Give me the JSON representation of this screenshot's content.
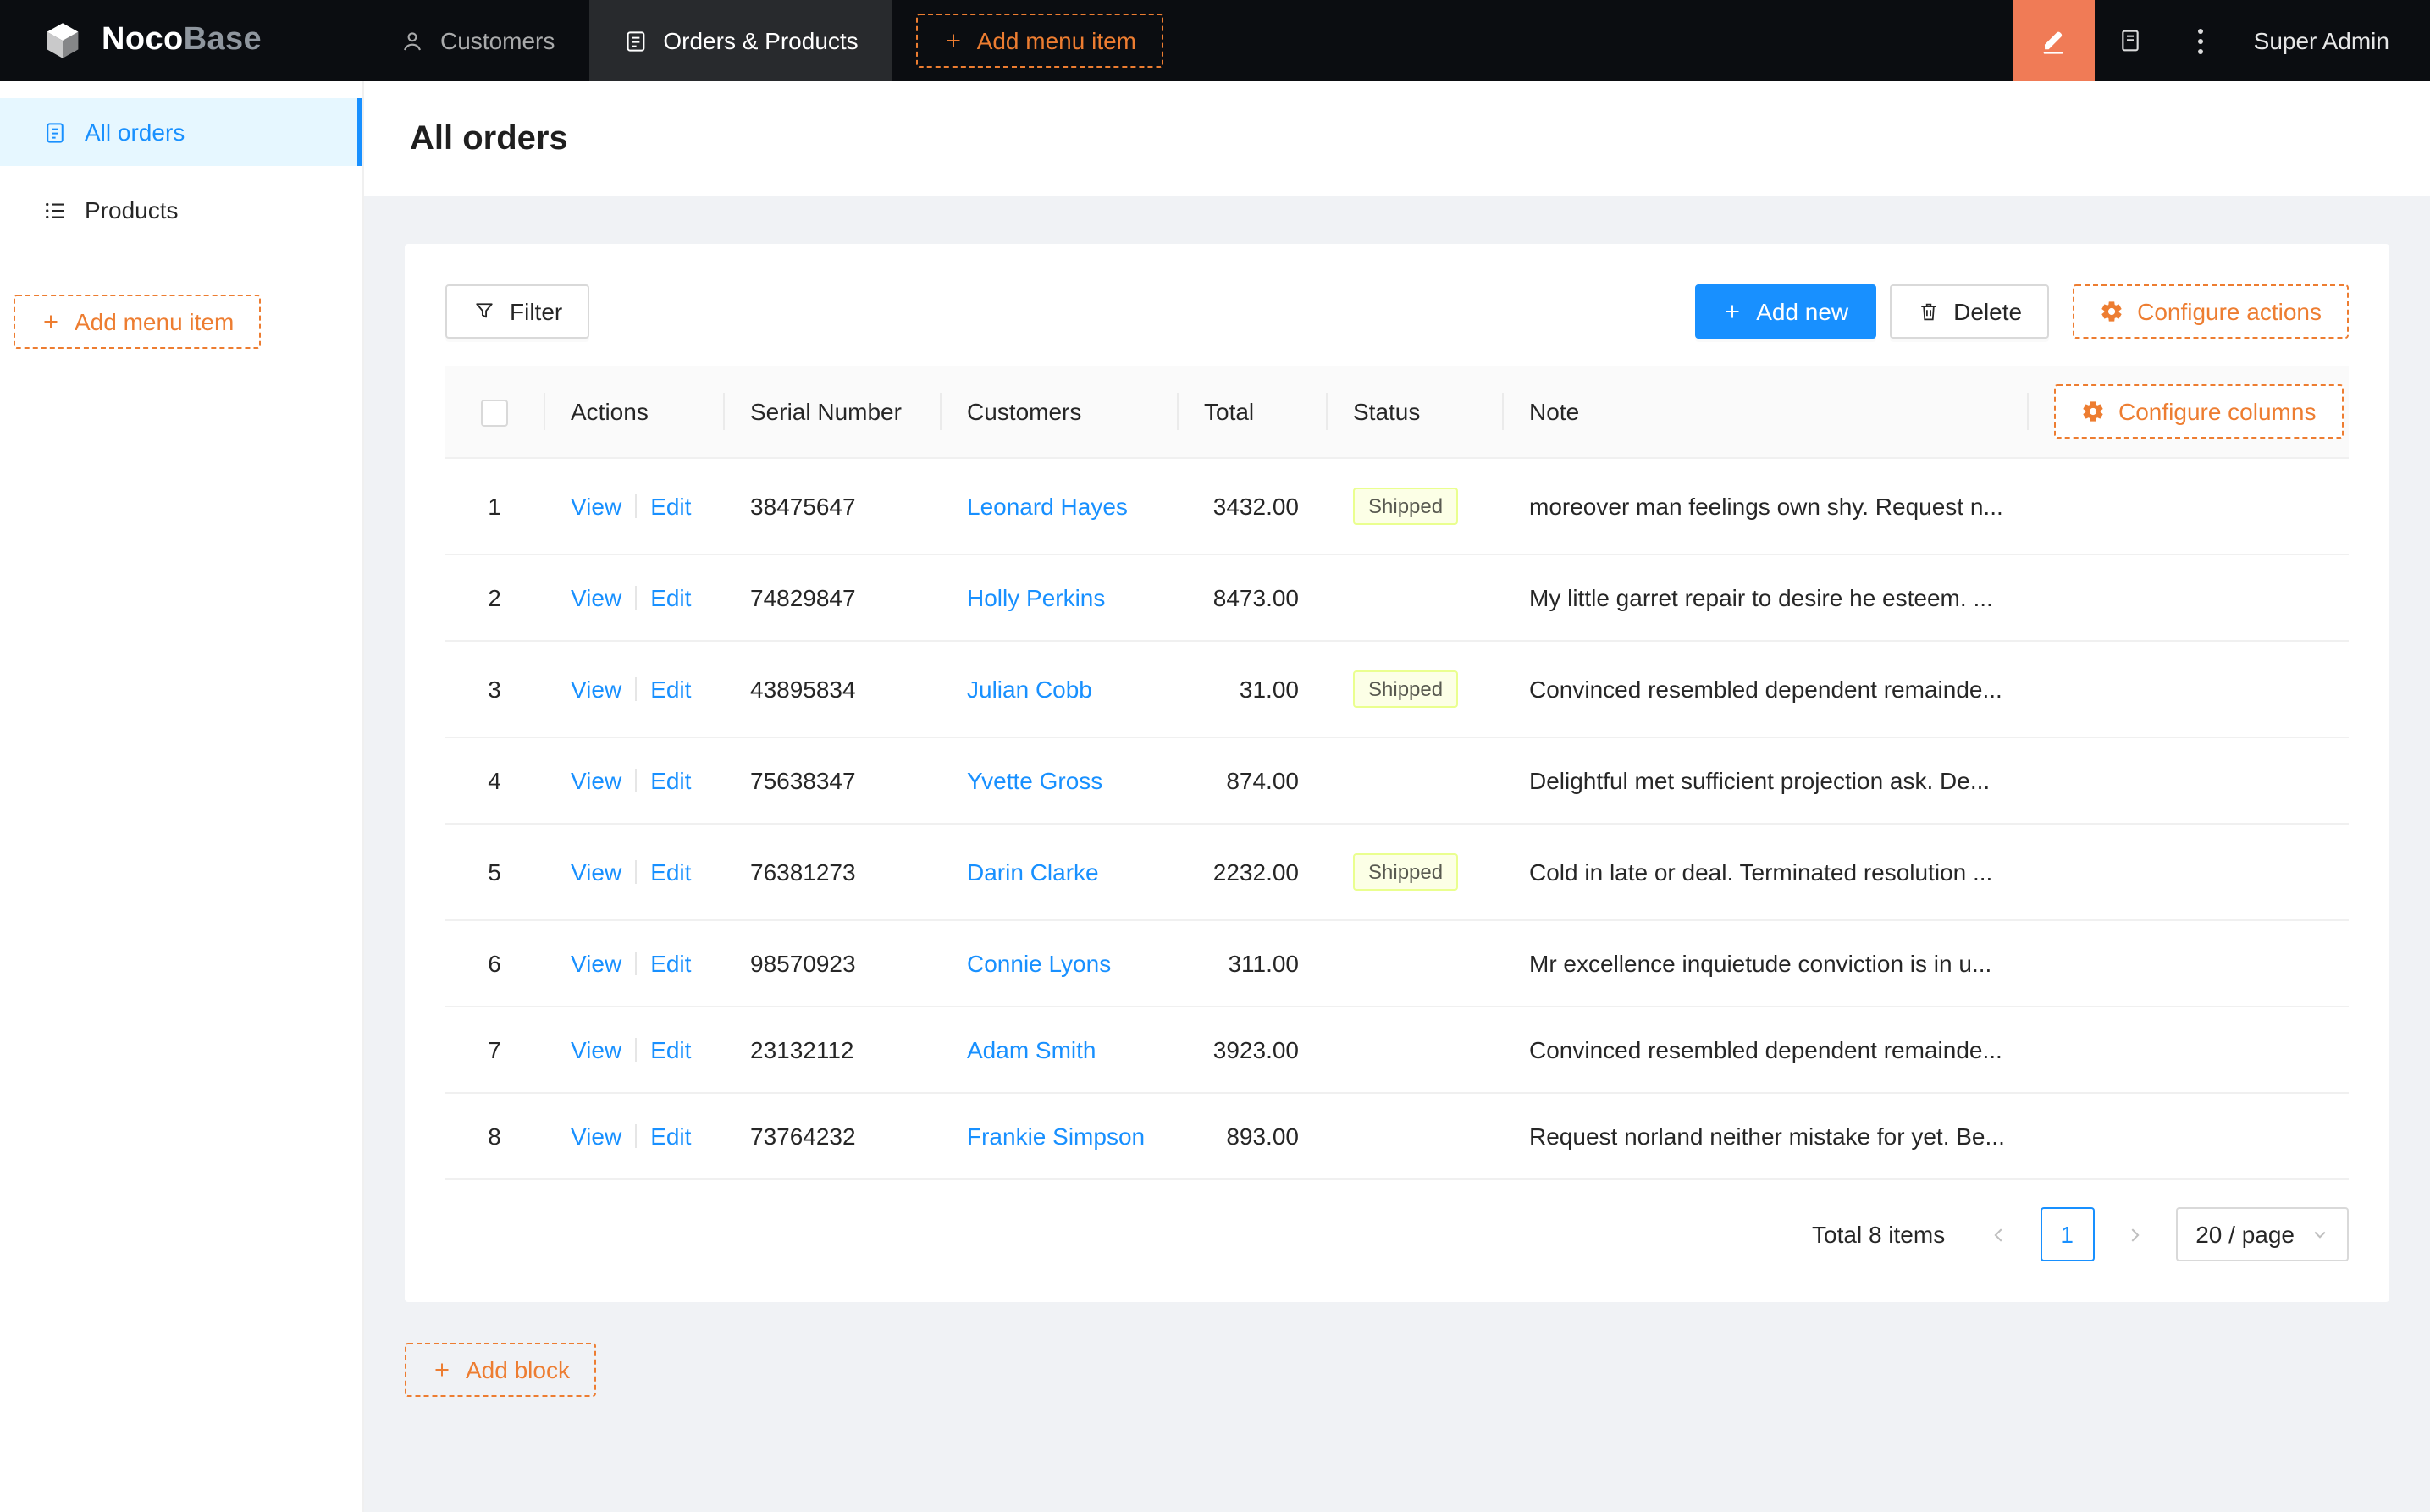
{
  "navbar": {
    "brand": {
      "primary": "Noco",
      "secondary": "Base"
    },
    "items": [
      {
        "label": "Customers"
      },
      {
        "label": "Orders & Products"
      }
    ],
    "add_menu_item_label": "Add menu item",
    "user_name": "Super Admin"
  },
  "sidebar": {
    "items": [
      {
        "label": "All orders"
      },
      {
        "label": "Products"
      }
    ],
    "add_menu_item_label": "Add menu item"
  },
  "page": {
    "title": "All orders"
  },
  "toolbar": {
    "filter_label": "Filter",
    "add_new_label": "Add new",
    "delete_label": "Delete",
    "configure_actions_label": "Configure actions"
  },
  "table": {
    "configure_columns_label": "Configure columns",
    "columns": [
      "Actions",
      "Serial Number",
      "Customers",
      "Total",
      "Status",
      "Note"
    ],
    "action_labels": {
      "view": "View",
      "edit": "Edit"
    },
    "rows": [
      {
        "index": 1,
        "serial": "38475647",
        "customer": "Leonard Hayes",
        "total": "3432.00",
        "status": "Shipped",
        "note": "moreover man feelings own shy. Request n..."
      },
      {
        "index": 2,
        "serial": "74829847",
        "customer": "Holly Perkins",
        "total": "8473.00",
        "status": "",
        "note": "My little garret repair to desire he esteem. ..."
      },
      {
        "index": 3,
        "serial": "43895834",
        "customer": "Julian Cobb",
        "total": "31.00",
        "status": "Shipped",
        "note": "Convinced resembled dependent remainde..."
      },
      {
        "index": 4,
        "serial": "75638347",
        "customer": "Yvette Gross",
        "total": "874.00",
        "status": "",
        "note": "Delightful met sufficient projection ask. De..."
      },
      {
        "index": 5,
        "serial": "76381273",
        "customer": "Darin Clarke",
        "total": "2232.00",
        "status": "Shipped",
        "note": "Cold in late or deal. Terminated resolution ..."
      },
      {
        "index": 6,
        "serial": "98570923",
        "customer": "Connie Lyons",
        "total": "311.00",
        "status": "",
        "note": "Mr excellence inquietude conviction is in u..."
      },
      {
        "index": 7,
        "serial": "23132112",
        "customer": "Adam Smith",
        "total": "3923.00",
        "status": "",
        "note": "Convinced resembled dependent remainde..."
      },
      {
        "index": 8,
        "serial": "73764232",
        "customer": "Frankie Simpson",
        "total": "893.00",
        "status": "",
        "note": "Request norland neither mistake for yet. Be..."
      }
    ]
  },
  "pagination": {
    "total_text": "Total 8 items",
    "current_page": "1",
    "page_size_label": "20 / page"
  },
  "footer": {
    "add_block_label": "Add block"
  },
  "icons": {
    "logo": "cube",
    "customers": "user-outline",
    "orders_products": "form-outline",
    "add": "plus",
    "ui_editor": "highlighter-pen",
    "docs": "book",
    "more": "kebab-dots",
    "all_orders": "file-outline",
    "products": "unordered-list",
    "filter": "funnel",
    "delete": "trash",
    "configure": "gear",
    "prev": "chevron-left",
    "next": "chevron-right",
    "select_caret": "chevron-down"
  },
  "colors": {
    "primary": "#1890ff",
    "designer_orange": "#ed7d31",
    "designer_toggle_bg": "#f07b56",
    "navbar_bg": "#0b0d11",
    "sidebar_active_bg": "#e6f7ff",
    "status_shipped_bg": "#fcffe6",
    "status_shipped_border": "#eaff8f",
    "content_bg": "#f0f2f5"
  }
}
